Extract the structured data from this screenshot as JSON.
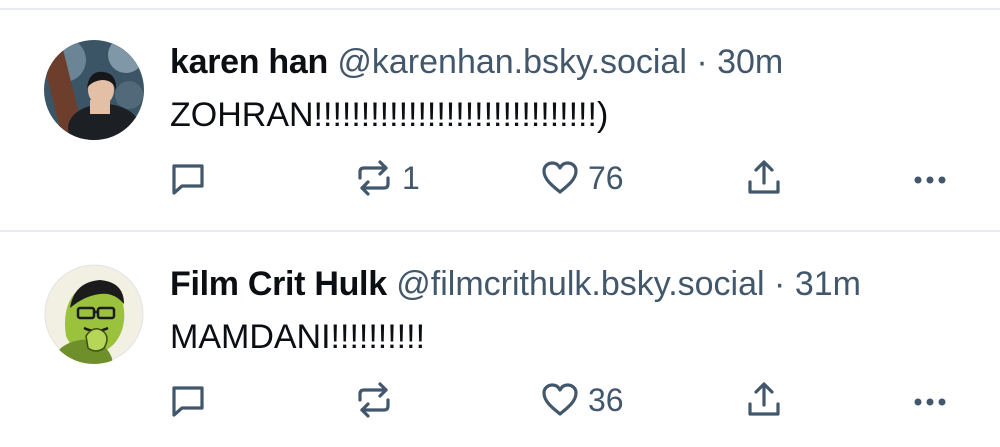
{
  "posts": [
    {
      "author_name": "karen han",
      "handle": "@karenhan.bsky.social",
      "separator": "·",
      "time": "30m",
      "text": "ZOHRAN!!!!!!!!!!!!!!!!!!!!!!!!!!!!!!)",
      "reply_count": "",
      "repost_count": "1",
      "like_count": "76"
    },
    {
      "author_name": "Film Crit Hulk",
      "handle": "@filmcrithulk.bsky.social",
      "separator": "·",
      "time": "31m",
      "text": "MAMDANI!!!!!!!!!!",
      "reply_count": "",
      "repost_count": "",
      "like_count": "36"
    }
  ],
  "colors": {
    "text": "#0b0f14",
    "secondary": "#42576c",
    "divider": "#e8ecf0"
  },
  "icons": [
    "reply-icon",
    "repost-icon",
    "like-icon",
    "share-icon",
    "more-icon"
  ]
}
